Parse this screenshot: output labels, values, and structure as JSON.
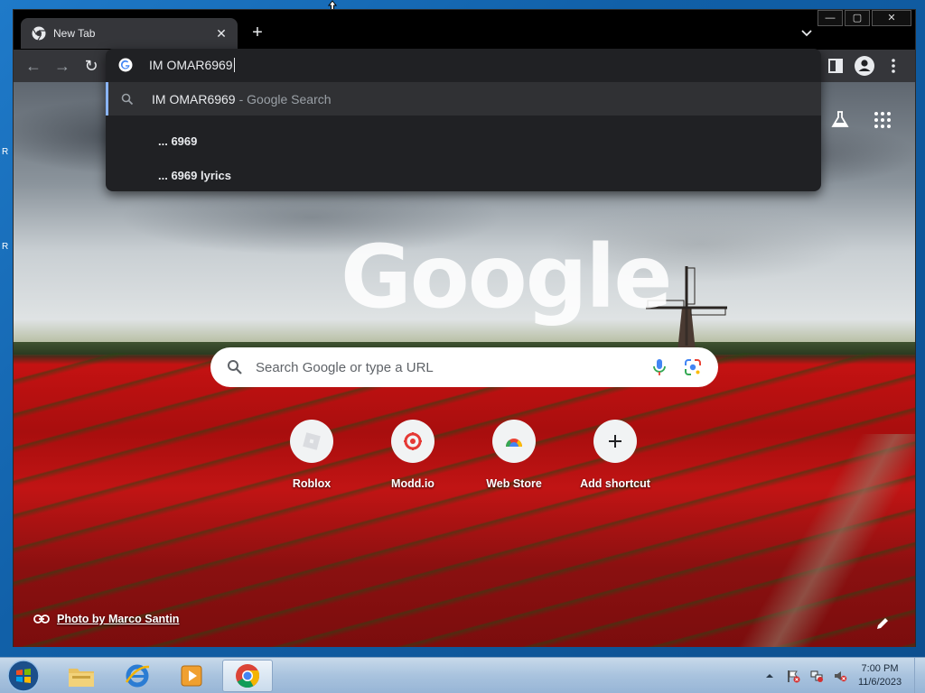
{
  "browser": {
    "tab_title": "New Tab",
    "tab_close": "✕",
    "new_tab": "+",
    "window_controls": {
      "minimize": "—",
      "maximize": "▢",
      "close": "✕"
    }
  },
  "toolbar": {
    "back": "←",
    "forward": "→",
    "reload": "↻"
  },
  "omnibox": {
    "input_value": "IM OMAR6969",
    "selected_suggestion": {
      "query": "IM OMAR6969",
      "separator_text": "- Google Search"
    },
    "suggestions": [
      {
        "text": "... 6969"
      },
      {
        "text": "... 6969 lyrics"
      }
    ]
  },
  "newtab": {
    "logo": "Google",
    "search_placeholder": "Search Google or type a URL",
    "shortcuts": [
      {
        "label": "Roblox"
      },
      {
        "label": "Modd.io"
      },
      {
        "label": "Web Store"
      },
      {
        "label": "Add shortcut"
      }
    ],
    "photo_credit": "Photo by Marco Santin"
  },
  "taskbar": {
    "clock_time": "7:00 PM",
    "clock_date": "11/6/2023"
  },
  "desktop": {
    "letters": [
      "R",
      "R"
    ]
  },
  "colors": {
    "tab_bg": "#35363a",
    "dropdown_bg": "#202124",
    "dropdown_selected": "#303134",
    "accent": "#8ab4f8"
  }
}
